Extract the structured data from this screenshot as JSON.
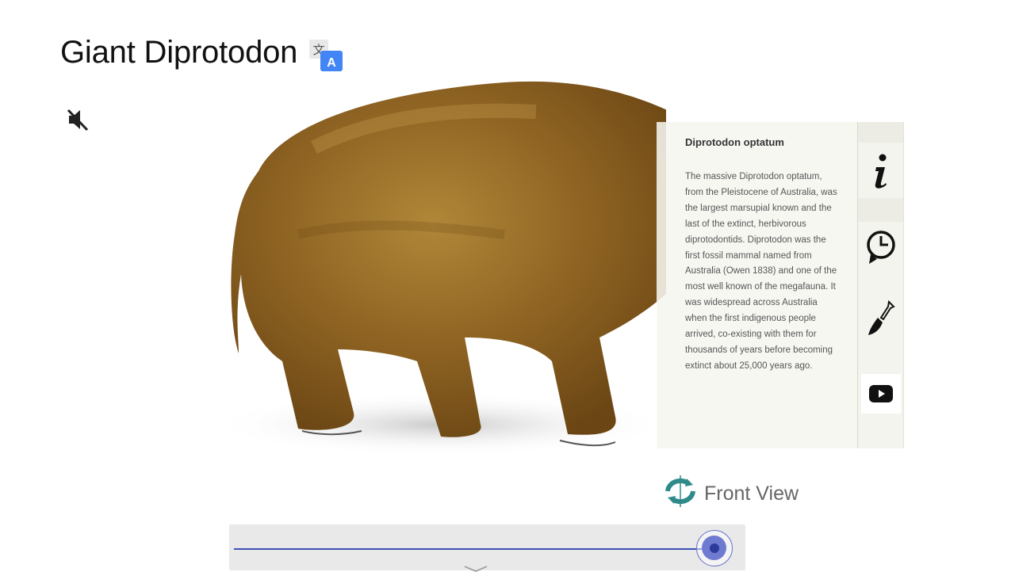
{
  "page": {
    "title": "Giant Diprotodon"
  },
  "icons": {
    "translate": "translate-icon",
    "mute": "speaker-muted-icon",
    "info": "info-icon",
    "history": "clock-history-icon",
    "dig": "shovel-icon",
    "video": "youtube-icon",
    "rotate": "rotate-view-icon"
  },
  "info_panel": {
    "heading": "Diprotodon optatum",
    "body": "The massive Diprotodon optatum, from the Pleistocene of Australia, was the largest marsupial known and the last of the extinct, herbivorous diprotodontids. Diprotodon was the first fossil mammal named from Australia (Owen 1838) and one of the most well known of the megafauna. It was widespread across Australia when the first indigenous people arrived, co-existing with them for thousands of years before becoming extinct about 25,000 years ago."
  },
  "view": {
    "label": "Front View"
  },
  "slider": {
    "value": 1.0
  },
  "colors": {
    "accent": "#3f51b5",
    "fur": "#8f6520",
    "panel_bg": "#f6f6f0"
  }
}
